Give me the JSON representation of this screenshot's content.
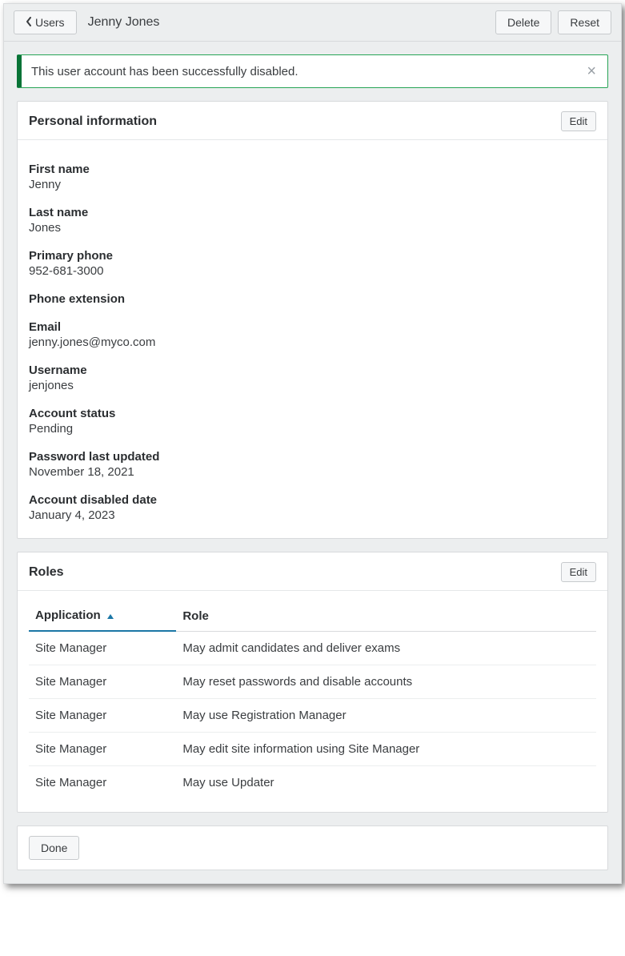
{
  "topbar": {
    "back_label": "Users",
    "title": "Jenny Jones",
    "delete_label": "Delete",
    "reset_label": "Reset"
  },
  "alert": {
    "message": "This user account has been successfully disabled."
  },
  "personal": {
    "title": "Personal information",
    "edit_label": "Edit",
    "fields": {
      "first_name_label": "First name",
      "first_name_value": "Jenny",
      "last_name_label": "Last name",
      "last_name_value": "Jones",
      "primary_phone_label": "Primary phone",
      "primary_phone_value": "952-681-3000",
      "phone_ext_label": "Phone extension",
      "phone_ext_value": "",
      "email_label": "Email",
      "email_value": "jenny.jones@myco.com",
      "username_label": "Username",
      "username_value": "jenjones",
      "account_status_label": "Account status",
      "account_status_value": "Pending",
      "pwd_updated_label": "Password last updated",
      "pwd_updated_value": "November 18, 2021",
      "disabled_date_label": "Account disabled date",
      "disabled_date_value": "January 4, 2023"
    }
  },
  "roles": {
    "title": "Roles",
    "edit_label": "Edit",
    "columns": {
      "application": "Application",
      "role": "Role"
    },
    "rows": [
      {
        "application": "Site Manager",
        "role": "May admit candidates and deliver exams"
      },
      {
        "application": "Site Manager",
        "role": "May reset passwords and disable accounts"
      },
      {
        "application": "Site Manager",
        "role": "May use Registration Manager"
      },
      {
        "application": "Site Manager",
        "role": "May edit site information using Site Manager"
      },
      {
        "application": "Site Manager",
        "role": "May use Updater"
      }
    ]
  },
  "footer": {
    "done_label": "Done"
  }
}
